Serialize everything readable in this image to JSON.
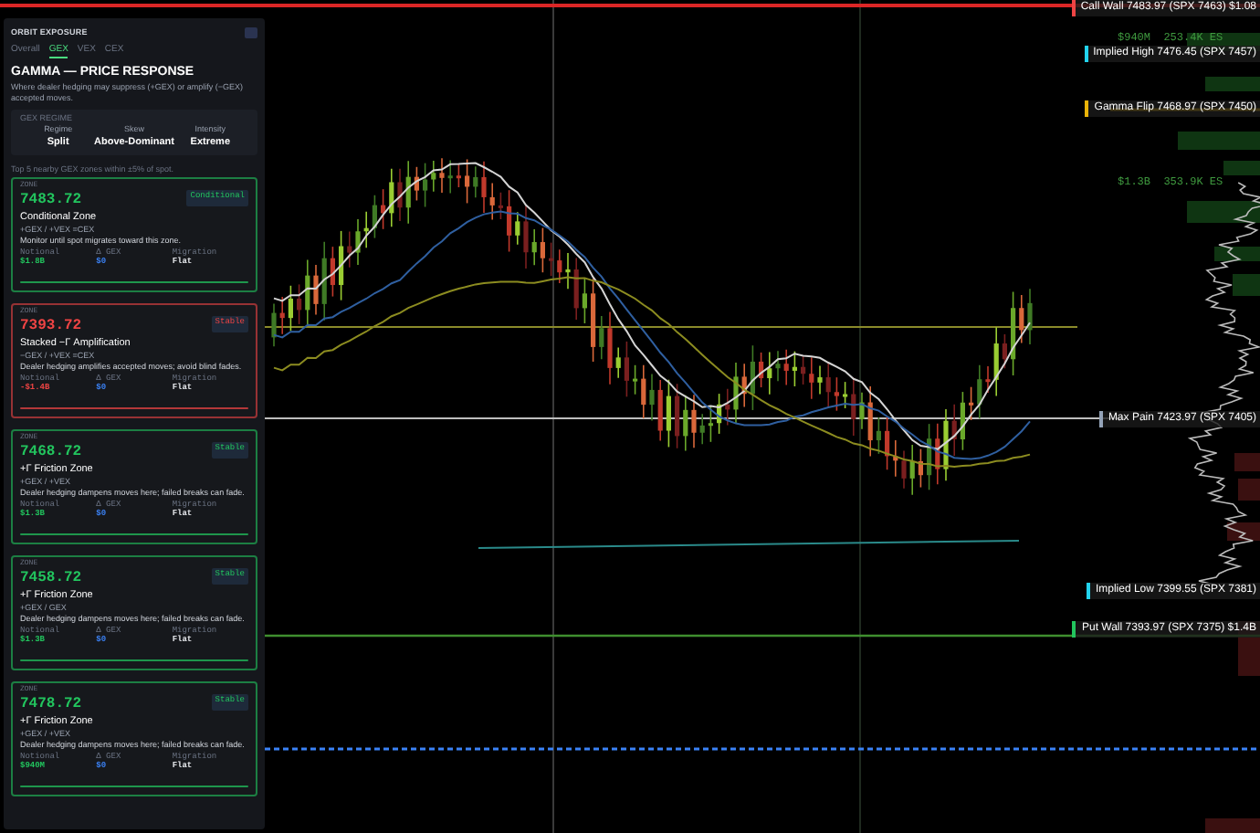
{
  "chart": {
    "labels": [
      {
        "kind": "level",
        "text": "Call Wall  7483.97  (SPX 7463)  $1.08",
        "color": "#ef4444"
      },
      {
        "kind": "volume",
        "text": "$940M  253.4K ES"
      },
      {
        "kind": "level",
        "text": "Implied High  7476.45  (SPX 7457)",
        "color": "#22d3ee"
      },
      {
        "kind": "level",
        "text": "Gamma Flip  7468.97  (SPX 7450)",
        "color": "#eab308"
      },
      {
        "kind": "volume",
        "text": "$1.3B  353.9K ES"
      },
      {
        "kind": "level",
        "text": "Max Pain  7423.97  (SPX 7405)",
        "color": "#94a3b8"
      },
      {
        "kind": "level",
        "text": "Implied Low  7399.55  (SPX 7381)",
        "color": "#22d3ee"
      },
      {
        "kind": "level",
        "text": "Put Wall  7393.97  (SPX 7375)  $1.4B",
        "color": "#22c55e"
      }
    ]
  },
  "panel": {
    "title": "ORBIT EXPOSURE",
    "tabs": [
      {
        "label": "Overall",
        "selected": false
      },
      {
        "label": "GEX",
        "selected": true
      },
      {
        "label": "VEX",
        "selected": false
      },
      {
        "label": "CEX",
        "selected": false
      }
    ],
    "heading": "GAMMA — PRICE RESPONSE",
    "description": "Where dealer hedging may suppress (+GEX) or amplify (−GEX) accepted moves.",
    "regime": {
      "title": "GEX REGIME",
      "stats": [
        {
          "label": "Regime",
          "value": "Split"
        },
        {
          "label": "Skew",
          "value": "Above-Dominant"
        },
        {
          "label": "Intensity",
          "value": "Extreme"
        }
      ]
    },
    "zones_note": "Top 5 nearby GEX zones within ±5% of spot.",
    "zones": [
      {
        "label": "ZONE",
        "price": "7483.72",
        "badge": "Conditional",
        "name": "Conditional Zone",
        "formula": "+GEX / +VEX =CEX",
        "description": "Monitor until spot migrates toward this zone.",
        "color": "#22c55e",
        "metrics": [
          {
            "label": "Notional",
            "value": "$1.8B"
          },
          {
            "label": "Δ GEX",
            "value": "$0"
          },
          {
            "label": "Migration",
            "value": "Flat"
          }
        ]
      },
      {
        "label": "ZONE",
        "price": "7393.72",
        "badge": "Stable",
        "name": "Stacked −Γ Amplification",
        "formula": "−GEX / +VEX =CEX",
        "description": "Dealer hedging amplifies accepted moves; avoid blind fades.",
        "color": "#ef4444",
        "metrics": [
          {
            "label": "Notional",
            "value": "-$1.4B"
          },
          {
            "label": "Δ GEX",
            "value": "$0"
          },
          {
            "label": "Migration",
            "value": "Flat"
          }
        ]
      },
      {
        "label": "ZONE",
        "price": "7468.72",
        "badge": "Stable",
        "name": "+Γ Friction Zone",
        "formula": "+GEX / +VEX",
        "description": "Dealer hedging dampens moves here; failed breaks can fade.",
        "color": "#22c55e",
        "metrics": [
          {
            "label": "Notional",
            "value": "$1.3B"
          },
          {
            "label": "Δ GEX",
            "value": "$0"
          },
          {
            "label": "Migration",
            "value": "Flat"
          }
        ]
      },
      {
        "label": "ZONE",
        "price": "7458.72",
        "badge": "Stable",
        "name": "+Γ Friction Zone",
        "formula": "+GEX / GEX",
        "description": "Dealer hedging dampens moves here; failed breaks can fade.",
        "color": "#22c55e",
        "metrics": [
          {
            "label": "Notional",
            "value": "$1.3B"
          },
          {
            "label": "Δ GEX",
            "value": "$0"
          },
          {
            "label": "Migration",
            "value": "Flat"
          }
        ]
      },
      {
        "label": "ZONE",
        "price": "7478.72",
        "badge": "Stable",
        "name": "+Γ Friction Zone",
        "formula": "+GEX / +VEX",
        "description": "Dealer hedging dampens moves here; failed breaks can fade.",
        "color": "#22c55e",
        "metrics": [
          {
            "label": "Notional",
            "value": "$940M"
          },
          {
            "label": "Δ GEX",
            "value": "$0"
          },
          {
            "label": "Migration",
            "value": "Flat"
          }
        ]
      }
    ]
  }
}
